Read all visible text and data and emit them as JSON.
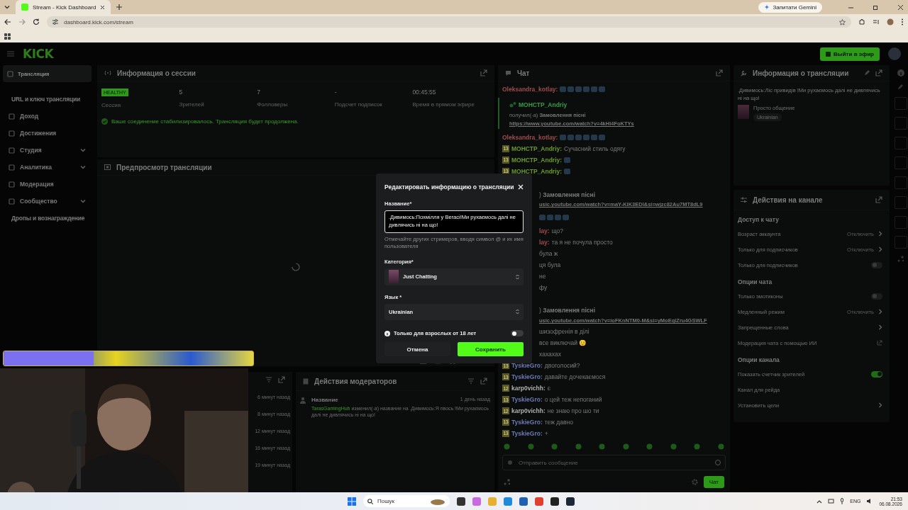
{
  "browser": {
    "tab_title": "Stream - Kick Dashboard",
    "url": "dashboard.kick.com/stream",
    "gemini_button": "Запитати Gemini"
  },
  "header": {
    "logo": "KICK",
    "go_live_button": "Выйти в эфир"
  },
  "sidebar": {
    "items": [
      {
        "kind": "link",
        "label": "Трансляция",
        "selected": true
      },
      {
        "kind": "sub",
        "label": "URL и ключ трансляции",
        "selected": false
      },
      {
        "kind": "link",
        "label": "Доход",
        "selected": false
      },
      {
        "kind": "link",
        "label": "Достижения",
        "selected": false
      },
      {
        "kind": "group",
        "label": "Студия",
        "selected": false,
        "expanded": false
      },
      {
        "kind": "group",
        "label": "Аналитика",
        "selected": false,
        "expanded": false
      },
      {
        "kind": "link",
        "label": "Модерация",
        "selected": false
      },
      {
        "kind": "group",
        "label": "Сообщество",
        "selected": false,
        "expanded": false
      },
      {
        "kind": "sub",
        "label": "Дропы и вознаграждение",
        "selected": false
      }
    ]
  },
  "session_panel": {
    "title": "Информация о сессии",
    "status_badge": "HEALTHY",
    "status_label": "Сессия",
    "stats": [
      {
        "value": "5",
        "label": "Зрителей"
      },
      {
        "value": "7",
        "label": "Фолловеры"
      },
      {
        "value": "-",
        "label": "Подсчет подписок"
      },
      {
        "value": "00:45:55",
        "label": "Время в прямом эфире"
      }
    ],
    "notice": "Ваше соединение стабилизировалось. Трансляция будет продолжена."
  },
  "preview_panel": {
    "title": "Предпросмотр трансляции",
    "loading": true
  },
  "activity_panel": {
    "times": [
      "6 минут назад",
      "8 минут назад",
      "12 минут назад",
      "16 минут назад",
      "19 минут назад"
    ]
  },
  "moderator_panel": {
    "title": "Действия модераторов",
    "entries": [
      {
        "title": "Название",
        "time": "1 день назад",
        "user": "TarasGamingHub",
        "text": "изменил(-а) название на .Дивимось:Я пвось !Ми рухаємось далі не дивлячись ні на що!"
      }
    ]
  },
  "chat": {
    "title": "Чат",
    "messages": [
      {
        "kind": "emotes",
        "user": "Oleksandra_kotlay:",
        "color": "#a04c4c"
      },
      {
        "kind": "reward",
        "user": "МОНСТР_Andriy",
        "color": "#3a9a4a",
        "text": "получил(-а) **Замовлення пісні**",
        "link": "https://www.youtube.com/watch?v=4kHl4FoKTYs"
      },
      {
        "kind": "emotes",
        "user": "Oleksandra_kotlay:",
        "color": "#a04c4c"
      },
      {
        "kind": "text",
        "badge": "13",
        "user": "МОНСТР_Andriy:",
        "color": "#6a9a2a",
        "text": "Сучасний стиль одягу"
      },
      {
        "kind": "emotes",
        "badge": "13",
        "user": "МОНСТР_Andriy:",
        "color": "#6a9a2a"
      },
      {
        "kind": "emotes",
        "badge": "13",
        "user": "МОНСТР_Andriy:",
        "color": "#6a9a2a"
      },
      {
        "kind": "partial-reward",
        "text": ") **Замовлення пісні**"
      },
      {
        "kind": "partial-link",
        "text": "usic.youtube.com/watch?v=maY-KlK3EDl&si=wjzc82Au7MT8dL9"
      },
      {
        "kind": "partial-emotes"
      },
      {
        "kind": "partial",
        "user_tail": "lay:",
        "color": "#a04c4c",
        "text": "що?"
      },
      {
        "kind": "partial",
        "user_tail": "lay:",
        "color": "#a04c4c",
        "text": "та я не почула просто"
      },
      {
        "kind": "partial",
        "text": "була ж"
      },
      {
        "kind": "partial",
        "text": "ця була"
      },
      {
        "kind": "partial",
        "text": "не"
      },
      {
        "kind": "partial",
        "text": "фу"
      },
      {
        "kind": "partial-reward",
        "text": ") **Замовлення пісні**"
      },
      {
        "kind": "partial-link",
        "text": "usic.youtube.com/watch?v=ioFKnNTM0-M&si=yMoEqiZru4GSWLF"
      },
      {
        "kind": "partial",
        "text": "шизофренія в ділі"
      },
      {
        "kind": "partial",
        "text": "все виключай 😊"
      },
      {
        "kind": "partial",
        "text": "хахахах"
      },
      {
        "kind": "text",
        "badge": "13",
        "user": "TyskieGro:",
        "color": "#6a78b8",
        "text": "двоголосий?"
      },
      {
        "kind": "text",
        "badge": "13",
        "user": "TyskieGro:",
        "color": "#6a78b8",
        "text": "давайте дочекаємося"
      },
      {
        "kind": "text",
        "badge": "12",
        "user": "karp0vichh:",
        "color": "#b0b0b0",
        "text": "є"
      },
      {
        "kind": "text",
        "badge": "13",
        "user": "TyskieGro:",
        "color": "#6a78b8",
        "text": "о цей теж непоганий"
      },
      {
        "kind": "text",
        "badge": "12",
        "user": "karp0vichh:",
        "color": "#b0b0b0",
        "text": "не знаю про шо ти"
      },
      {
        "kind": "text",
        "badge": "13",
        "user": "TyskieGro:",
        "color": "#6a78b8",
        "text": "теж давно"
      },
      {
        "kind": "text",
        "badge": "13",
        "user": "TyskieGro:",
        "color": "#6a78b8",
        "text": "+"
      }
    ],
    "input_placeholder": "Отправить сообщение",
    "send_button": "Чат"
  },
  "stream_info": {
    "title": "Информация о трансляции",
    "stream_title": ".Дивимось:Ліс привидів !Ми рухаємось далі не дивлячись ні на що!",
    "category": "Просто общение",
    "tags": [
      "Ukrainian"
    ]
  },
  "channel_actions": {
    "title": "Действия на канале",
    "sections": [
      {
        "title": "Доступ к чату",
        "rows": [
          {
            "kind": "link",
            "label": "Возраст аккаунта",
            "value": "Отключить"
          },
          {
            "kind": "link",
            "label": "Только для подписчиков",
            "value": "Отключить"
          },
          {
            "kind": "toggle",
            "label": "Только для подписчиков",
            "on": false
          }
        ]
      },
      {
        "title": "Опции чата",
        "rows": [
          {
            "kind": "toggle",
            "label": "Только эмотиконы",
            "on": false
          },
          {
            "kind": "link",
            "label": "Медленный режим",
            "value": "Отключить"
          },
          {
            "kind": "link",
            "label": "Запрещенные слова"
          },
          {
            "kind": "external",
            "label": "Модерация чата с помощью ИИ"
          }
        ]
      },
      {
        "title": "Опции канала",
        "rows": [
          {
            "kind": "toggle",
            "label": "Показать счетчик зрителей",
            "on": true
          },
          {
            "kind": "plain",
            "label": "Канал для рейда"
          },
          {
            "kind": "link",
            "label": "Установить цели"
          }
        ]
      }
    ]
  },
  "overlay": {
    "goal_bar": {
      "level": 0.36
    }
  },
  "modal": {
    "title": "Редактировать информацию о трансляции",
    "name_label": "Название*",
    "name_value": ".Дивимось:Похмілля у Вегасі!Ми рухаємось далі не дивлячись ні на що!",
    "hint": "Отмечайте других стримеров, вводя символ @ и их имя пользователя",
    "category_label": "Категория*",
    "category_value": "Just Chatting",
    "language_label": "Язык *",
    "language_value": "Ukrainian",
    "adult_label": "Только для взрослых от 18 лет",
    "adult_on": false,
    "cancel_button": "Отмена",
    "save_button": "Сохранить"
  },
  "taskbar": {
    "search": "Пошук",
    "language": "ENG",
    "time": "21:53",
    "date": "06.08.2026"
  }
}
